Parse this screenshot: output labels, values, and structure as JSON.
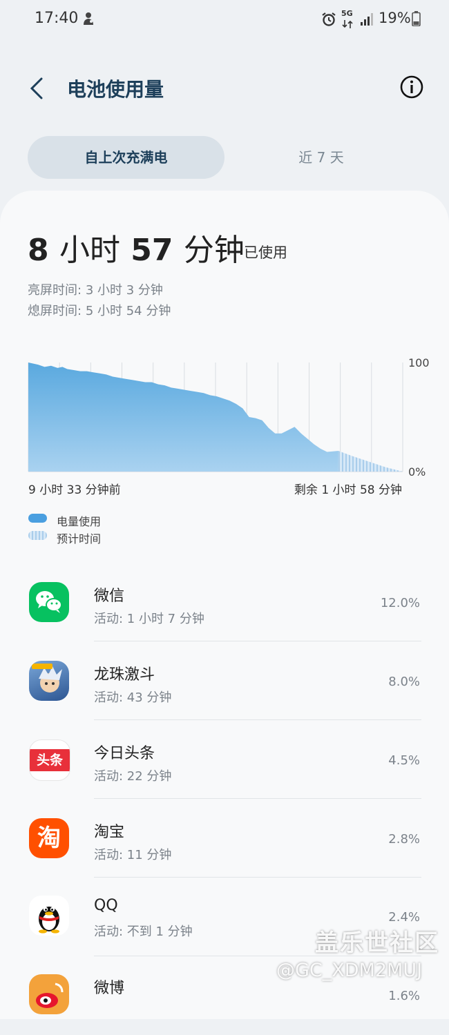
{
  "status_bar": {
    "time": "17:40",
    "battery_text": "19%",
    "network_label": "5G",
    "icons": [
      "notification-icon",
      "alarm-icon",
      "network-5g-icon",
      "signal-icon",
      "battery-icon"
    ]
  },
  "header": {
    "title": "电池使用量",
    "back_icon": "back-arrow-icon",
    "info_icon": "info-icon"
  },
  "tabs": [
    {
      "label": "自上次充满电",
      "active": true
    },
    {
      "label": "近 7 天",
      "active": false
    }
  ],
  "usage": {
    "hours": "8",
    "hours_unit": "小时",
    "minutes": "57",
    "minutes_unit": "分钟",
    "suffix": "已使用",
    "screen_on_label": "亮屏时间:",
    "screen_on_value": "3 小时 3 分钟",
    "screen_off_label": "熄屏时间:",
    "screen_off_value": "5 小时 54 分钟"
  },
  "chart_data": {
    "type": "area",
    "series": [
      {
        "name": "电量使用",
        "x": [
          0,
          0.3,
          0.5,
          0.7,
          0.9,
          1.05,
          1.2,
          1.4,
          1.6,
          1.8,
          2.0,
          2.2,
          2.4,
          2.6,
          2.8,
          3.0,
          3.2,
          3.4,
          3.6,
          3.8,
          4.0,
          4.2,
          4.4,
          4.6,
          4.8,
          5.0,
          5.2,
          5.4,
          5.6,
          5.8,
          6.0,
          6.2,
          6.4,
          6.6,
          6.8,
          7.0,
          7.2,
          7.4,
          7.6,
          7.8,
          8.0,
          8.2,
          8.4,
          8.6,
          8.8,
          9.0,
          9.2,
          9.55
        ],
        "values": [
          100,
          98,
          96,
          97,
          95,
          96,
          94,
          93,
          92,
          92,
          91,
          90,
          89,
          87,
          86,
          85,
          84,
          83,
          82,
          82,
          80,
          79,
          77,
          76,
          75,
          74,
          73,
          72,
          70,
          69,
          67,
          65,
          62,
          58,
          50,
          49,
          47,
          40,
          35,
          35,
          38,
          41,
          35,
          30,
          25,
          21,
          18,
          19
        ]
      },
      {
        "name": "预计时间",
        "x": [
          9.55,
          10.0,
          10.5,
          11.0,
          11.53
        ],
        "values": [
          19,
          14,
          9,
          4,
          0
        ]
      }
    ],
    "ylim": [
      0,
      100
    ],
    "y_tick_labels": [
      "100",
      "0%"
    ],
    "start_label": "9 小时 33 分钟前",
    "end_label": "剩余 1 小时 58 分钟",
    "grid": true,
    "legend_position": "bottom-left"
  },
  "legend": [
    {
      "label": "电量使用",
      "color": "#4a9fe0"
    },
    {
      "label": "预计时间",
      "color": "#c2dcf2"
    }
  ],
  "apps": [
    {
      "name": "微信",
      "activity": "活动: 1 小时 7 分钟",
      "percent": "12.0%",
      "icon": "wechat-icon",
      "icon_text": "",
      "color": "#07c160"
    },
    {
      "name": "龙珠激斗",
      "activity": "活动: 43 分钟",
      "percent": "8.0%",
      "icon": "dragonball-game-icon",
      "icon_text": "",
      "color": "#3a6fb0"
    },
    {
      "name": "今日头条",
      "activity": "活动: 22 分钟",
      "percent": "4.5%",
      "icon": "toutiao-icon",
      "icon_text": "头条",
      "color": "#e8303a"
    },
    {
      "name": "淘宝",
      "activity": "活动: 11 分钟",
      "percent": "2.8%",
      "icon": "taobao-icon",
      "icon_text": "淘",
      "color": "#ff5000"
    },
    {
      "name": "QQ",
      "activity": "活动: 不到 1 分钟",
      "percent": "2.4%",
      "icon": "qq-penguin-icon",
      "icon_text": "",
      "color": "#ffffff"
    },
    {
      "name": "微博",
      "activity": "",
      "percent": "1.6%",
      "icon": "weibo-icon",
      "icon_text": "",
      "color": "#f3a23b"
    }
  ],
  "watermark": {
    "line1": "盖乐世社区",
    "line2": "@GC_XDM2MUJ"
  },
  "colors": {
    "accent_dark": "#1d3f5a",
    "battery_fill": "#5fb0e3",
    "predicted_fill": "#c2dcf2"
  }
}
